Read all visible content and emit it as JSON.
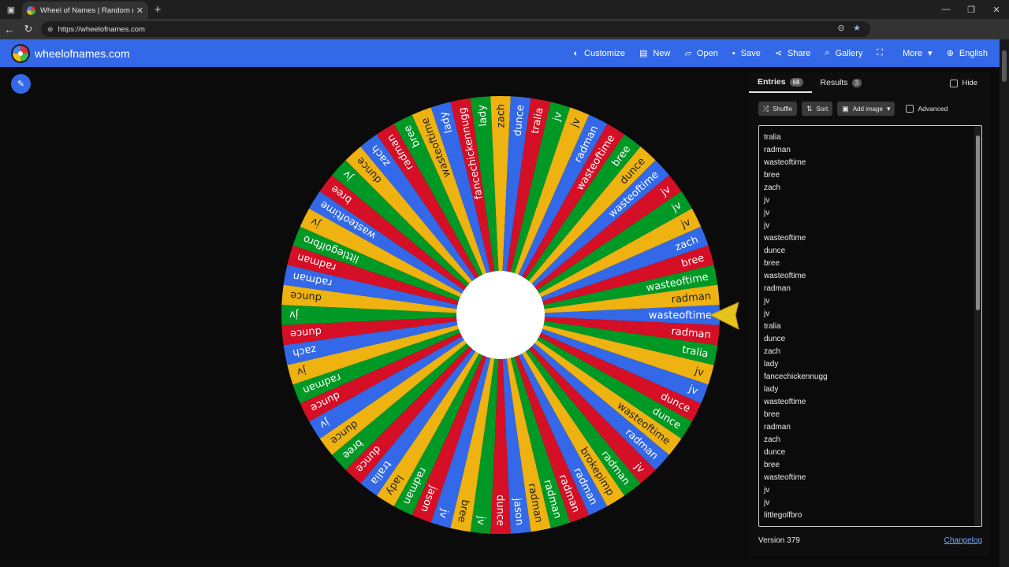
{
  "browser": {
    "tab_title": "Wheel of Names | Random name",
    "url": "https://wheelofnames.com"
  },
  "site": {
    "brand": "wheelofnames.com",
    "menu": [
      {
        "label": "Customize",
        "icon": "palette-icon"
      },
      {
        "label": "New",
        "icon": "file-icon"
      },
      {
        "label": "Open",
        "icon": "folder-icon"
      },
      {
        "label": "Save",
        "icon": "save-icon"
      },
      {
        "label": "Share",
        "icon": "share-icon"
      },
      {
        "label": "Gallery",
        "icon": "search-icon"
      },
      {
        "label": "",
        "icon": "fullscreen-icon"
      },
      {
        "label": "More",
        "icon": "chevron-down-icon"
      },
      {
        "label": "English",
        "icon": "globe-icon"
      }
    ]
  },
  "panel": {
    "tabs": [
      {
        "label": "Entries",
        "count": "68"
      },
      {
        "label": "Results",
        "count": "3"
      }
    ],
    "hide_label": "Hide",
    "tools": {
      "shuffle": "Shuffle",
      "sort": "Sort",
      "add_image": "Add image",
      "advanced": "Advanced"
    },
    "entries": [
      "tralia",
      "radman",
      "wasteoftime",
      "bree",
      "zach",
      "jv",
      "jv",
      "jv",
      "wasteoftime",
      "dunce",
      "bree",
      "wasteoftime",
      "radman",
      "jv",
      "jv",
      "tralia",
      "dunce",
      "zach",
      "lady",
      "fancechickennugg",
      "lady",
      "wasteoftime",
      "bree",
      "radman",
      "zach",
      "dunce",
      "bree",
      "wasteoftime",
      "jv",
      "jv",
      "littlegolfbro"
    ],
    "version": "Version 379",
    "changelog": "Changelog"
  },
  "wheel": {
    "colors": [
      "#3369e8",
      "#d50f25",
      "#009925",
      "#eeb211"
    ],
    "text_colors": [
      "#ffffff",
      "#ffffff",
      "#ffffff",
      "#222222"
    ],
    "pointer_color": "#e6c31a",
    "segments": [
      "wasteoftime",
      "radman",
      "tralia",
      "jv",
      "jv",
      "dunce",
      "dunce",
      "wasteoftime",
      "radman",
      "jv",
      "radman",
      "brokepimp",
      "radman",
      "radman",
      "radman",
      "radman",
      "jason",
      "dunce",
      "jv",
      "bree",
      "jv",
      "jason",
      "radman",
      "lady",
      "tralia",
      "dunce",
      "bree",
      "dunce",
      "jv",
      "dunce",
      "radman",
      "jv",
      "zach",
      "dunce",
      "jv",
      "dunce",
      "radman",
      "radman",
      "littlegolfbro",
      "jv",
      "wasteoftime",
      "bree",
      "jv",
      "dunce",
      "zach",
      "radman",
      "bree",
      "wasteoftime",
      "lady",
      "fancechickennugg",
      "lady",
      "zach",
      "dunce",
      "tralia",
      "jv",
      "jv",
      "radman",
      "wasteoftime",
      "bree",
      "dunce",
      "wasteoftime",
      "jv",
      "jv",
      "jv",
      "zach",
      "bree",
      "wasteoftime",
      "radman"
    ]
  }
}
